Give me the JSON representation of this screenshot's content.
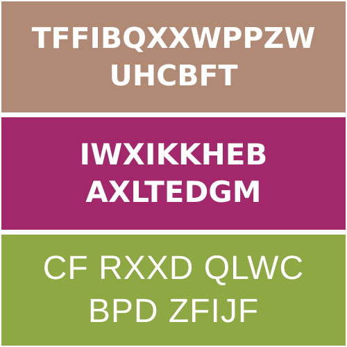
{
  "panels": [
    {
      "color": "#b08a74",
      "lines": [
        "TFFIBQXXWPPZW",
        "UHCBFT"
      ]
    },
    {
      "color": "#a3286b",
      "lines": [
        "IWXIKKHEB",
        "AXLTEDGM"
      ]
    },
    {
      "color": "#8ea843",
      "lines": [
        "CF RXXD QLWC",
        "BPD ZFIJF"
      ]
    }
  ]
}
